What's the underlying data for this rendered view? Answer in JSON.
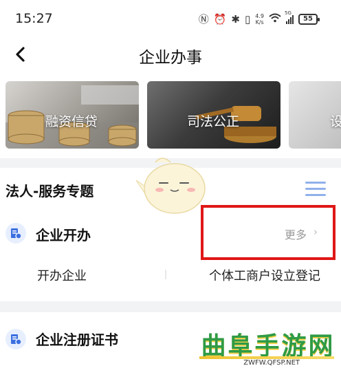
{
  "status_bar": {
    "time": "15:27",
    "speed_value": "4.9",
    "speed_unit": "K/s",
    "signal_label": "5G",
    "battery": "55"
  },
  "nav": {
    "title": "企业办事"
  },
  "banners": [
    {
      "label": "融资信贷"
    },
    {
      "label": "司法公正"
    },
    {
      "label": "设"
    }
  ],
  "section": {
    "title": "法人-服务专题"
  },
  "category1": {
    "title": "企业开办",
    "more_label": "更多",
    "items": [
      "开办企业",
      "个体工商户设立登记"
    ]
  },
  "category2": {
    "title": "企业注册证书"
  },
  "watermark": {
    "text": "曲阜手游网",
    "url": "ZWFW.QFSP.NET"
  },
  "colors": {
    "accent_blue": "#3b6fe0",
    "highlight_red": "#e01717",
    "watermark_green": "#2f9b46"
  }
}
